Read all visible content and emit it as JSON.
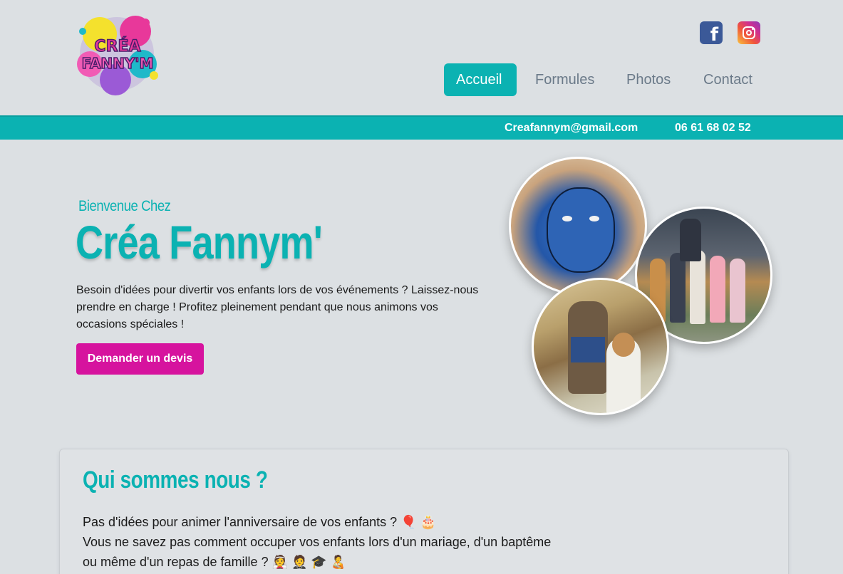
{
  "brand": {
    "logo_text": "CRÉA FANNY'M"
  },
  "nav": {
    "items": [
      {
        "label": "Accueil",
        "active": true
      },
      {
        "label": "Formules"
      },
      {
        "label": "Photos"
      },
      {
        "label": "Contact"
      }
    ]
  },
  "social": {
    "facebook_icon": "facebook-icon",
    "instagram_icon": "instagram-icon"
  },
  "contact": {
    "email": "Creafannym@gmail.com",
    "phone": "06 61 68 02 52"
  },
  "hero": {
    "welcome": "Bienvenue Chez",
    "title": "Créa Fannym'",
    "text": "Besoin d'idées pour divertir vos enfants lors de vos événements ? Laissez-nous prendre en charge ! Profitez pleinement pendant que nous animons vos occasions spéciales !",
    "cta": "Demander un devis"
  },
  "about": {
    "title": "Qui sommes nous ?",
    "line1": "Pas d'idées pour animer l'anniversaire de vos enfants ? 🎈 🎂",
    "line2": "Vous ne savez pas comment occuper vos enfants lors d'un mariage, d'un baptême",
    "line3": "ou même d'un repas de famille ? 👰 🤵 🎓 🧑‍🍼"
  },
  "colors": {
    "accent": "#0bb2b2",
    "cta": "#d6139e",
    "background": "#dce0e3",
    "nav_inactive": "#6b7a89"
  }
}
